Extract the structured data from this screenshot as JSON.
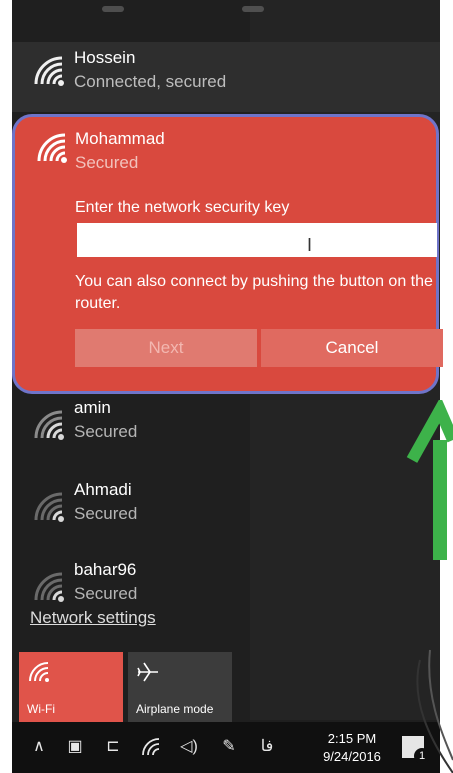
{
  "networks": [
    {
      "name": "Hossein",
      "status": "Connected, secured"
    },
    {
      "name": "Mohammad",
      "status": "Secured"
    },
    {
      "name": "amin",
      "status": "Secured"
    },
    {
      "name": "Ahmadi",
      "status": "Secured"
    },
    {
      "name": "bahar96",
      "status": "Secured"
    }
  ],
  "expanded": {
    "prompt": "Enter the network security key",
    "key_value": "",
    "push_text": "You can also connect by pushing the button on the router.",
    "next_label": "Next",
    "cancel_label": "Cancel"
  },
  "network_settings_label": "Network settings",
  "tiles": {
    "wifi_label": "Wi-Fi",
    "airplane_label": "Airplane mode"
  },
  "taskbar": {
    "time": "2:15 PM",
    "date": "9/24/2016",
    "notification_count": "1",
    "language_indicator": "فا"
  },
  "colors": {
    "accent_red": "#d9493e",
    "panel_bg": "#1f1f1f",
    "focus_ring": "#6f74c9",
    "arrow_green": "#3db24a"
  },
  "icons": {
    "wifi": "wifi-icon",
    "airplane": "airplane-icon",
    "chevron": "chevron-up-icon",
    "notification": "notification-icon"
  }
}
